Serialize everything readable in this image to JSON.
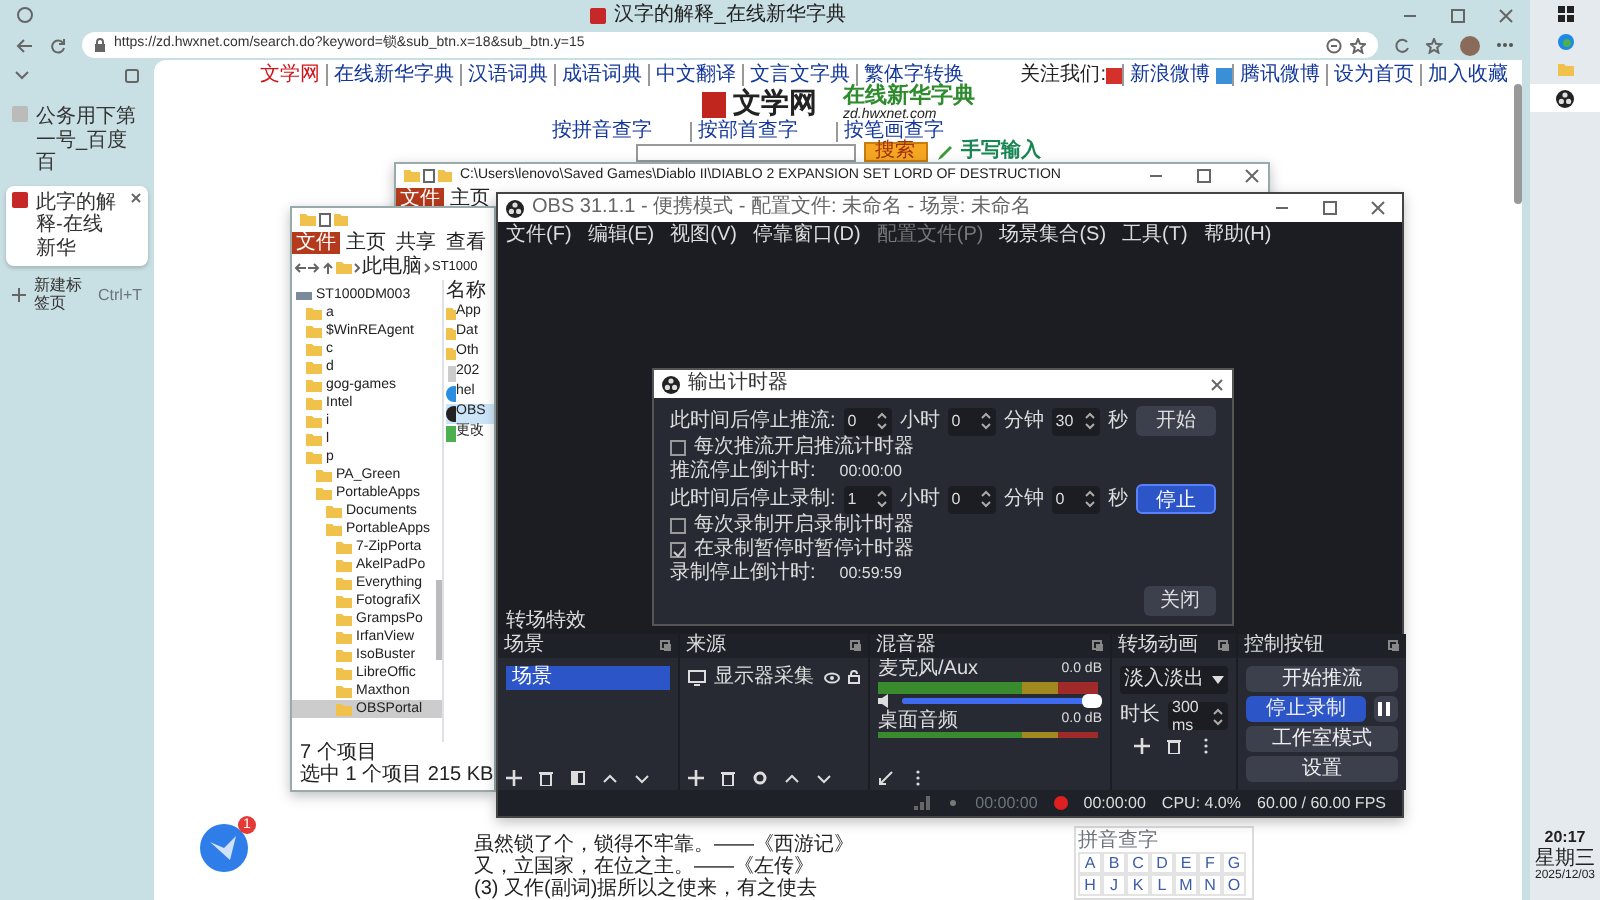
{
  "browser": {
    "title": "汉字的解释_在线新华字典",
    "url": "https://zd.hwxnet.com/search.do?keyword=锁&sub_btn.x=18&sub_btn.y=15",
    "tabs": [
      {
        "label": "公务用下第一号_百度百",
        "selected": false
      },
      {
        "label": "此字的解释-在线新华",
        "selected": true
      }
    ],
    "new_tab": {
      "label": "新建标签页",
      "shortcut": "Ctrl+T"
    }
  },
  "site": {
    "top_links": [
      {
        "label": "文学网",
        "selected": true
      },
      {
        "label": "在线新华字典",
        "selected": false
      },
      {
        "label": "汉语词典",
        "selected": false
      },
      {
        "label": "成语词典",
        "selected": false
      },
      {
        "label": "中文翻译",
        "selected": false
      },
      {
        "label": "文言文字典",
        "selected": false
      },
      {
        "label": "繁体字转换",
        "selected": false
      }
    ],
    "follow_label": "关注我们:",
    "follow_links": [
      "新浪微博",
      "腾讯微博",
      "设为首页",
      "加入收藏"
    ],
    "logo_text": "文学网",
    "site_name": "在线新华字典",
    "site_domain": "zd.hwxnet.com",
    "lookup_links": [
      "按拼音查字",
      "按部首查字",
      "按笔画查字"
    ],
    "search_button": "搜索",
    "handwriting": "手写输入",
    "body_lines": [
      "虽然锁了个，锁得不牢靠。——《西游记》",
      "又，立国家，在位之主。——《左传》",
      "(3) 又作(副词)据所以之使来，有之使去"
    ],
    "pinyin_title": "拼音查字",
    "pinyin_letters": [
      "A",
      "B",
      "C",
      "D",
      "E",
      "F",
      "G",
      "H",
      "J",
      "K",
      "L",
      "M",
      "N",
      "O"
    ],
    "float_badge": "1"
  },
  "explorer_back": {
    "title": "C:\\Users\\lenovo\\Saved Games\\Diablo II\\DIABLO 2 EXPANSION SET LORD OF DESTRUCTION",
    "ribbon_tabs": [
      {
        "label": "文件",
        "selected": true
      },
      {
        "label": "主页",
        "selected": false
      }
    ]
  },
  "explorer": {
    "ribbon_tabs": [
      {
        "label": "文件",
        "selected": true
      },
      {
        "label": "主页",
        "selected": false
      },
      {
        "label": "共享",
        "selected": false
      },
      {
        "label": "查看",
        "selected": false
      }
    ],
    "breadcrumb": [
      "此电脑",
      "ST1000"
    ],
    "tree": [
      {
        "label": "ST1000DM003",
        "selected": false,
        "children": [
          {
            "label": "a",
            "selected": false
          },
          {
            "label": "$WinREAgent",
            "selected": false
          },
          {
            "label": "c",
            "selected": false
          },
          {
            "label": "d",
            "selected": false
          },
          {
            "label": "gog-games",
            "selected": false
          },
          {
            "label": "Intel",
            "selected": false
          },
          {
            "label": "i",
            "selected": false
          },
          {
            "label": "l",
            "selected": false
          },
          {
            "label": "p",
            "selected": false,
            "children": [
              {
                "label": "PA_Green",
                "selected": false
              },
              {
                "label": "PortableApps",
                "selected": false,
                "children": [
                  {
                    "label": "Documents",
                    "selected": false
                  },
                  {
                    "label": "PortableApps",
                    "selected": false,
                    "children": [
                      {
                        "label": "7-ZipPorta",
                        "selected": false
                      },
                      {
                        "label": "AkelPadPo",
                        "selected": false
                      },
                      {
                        "label": "Everything",
                        "selected": false
                      },
                      {
                        "label": "FotografiX",
                        "selected": false
                      },
                      {
                        "label": "GrampsPo",
                        "selected": false
                      },
                      {
                        "label": "IrfanView",
                        "selected": false
                      },
                      {
                        "label": "IsoBuster",
                        "selected": false
                      },
                      {
                        "label": "LibreOffic",
                        "selected": false
                      },
                      {
                        "label": "Maxthon",
                        "selected": false
                      },
                      {
                        "label": "OBSPortal",
                        "selected": true
                      }
                    ]
                  }
                ]
              }
            ]
          }
        ]
      }
    ],
    "column": "名称",
    "files": [
      {
        "label": "App",
        "kind": "folder",
        "selected": false
      },
      {
        "label": "Dat",
        "kind": "folder",
        "selected": false
      },
      {
        "label": "Oth",
        "kind": "folder",
        "selected": false
      },
      {
        "label": "202",
        "kind": "file",
        "selected": false
      },
      {
        "label": "hel",
        "kind": "browser",
        "selected": false
      },
      {
        "label": "OBS",
        "kind": "app",
        "selected": true
      },
      {
        "label": "更改",
        "kind": "shortcut",
        "selected": false
      }
    ],
    "status": "7 个项目",
    "selection": "选中 1 个项目 215 KB"
  },
  "obs": {
    "title": "OBS 31.1.1 - 便携模式 - 配置文件: 未命名 - 场景: 未命名",
    "menu": [
      {
        "label": "文件(F)",
        "disabled": false
      },
      {
        "label": "编辑(E)",
        "disabled": false
      },
      {
        "label": "视图(V)",
        "disabled": false
      },
      {
        "label": "停靠窗口(D)",
        "disabled": false
      },
      {
        "label": "配置文件(P)",
        "disabled": true
      },
      {
        "label": "场景集合(S)",
        "disabled": false
      },
      {
        "label": "工具(T)",
        "disabled": false
      },
      {
        "label": "帮助(H)",
        "disabled": false
      }
    ],
    "timer_dialog": {
      "title": "输出计时器",
      "rows": [
        {
          "kind": "timer",
          "label": "此时间后停止推流:",
          "values": [
            "0",
            "0",
            "30"
          ],
          "units": [
            "小时",
            "分钟",
            "秒"
          ],
          "button": {
            "label": "开始",
            "active": false
          }
        },
        {
          "kind": "check",
          "label": "每次推流开启推流计时器",
          "checked": false
        },
        {
          "kind": "readout",
          "label": "推流停止倒计时:",
          "value": "00:00:00"
        },
        {
          "kind": "timer",
          "label": "此时间后停止录制:",
          "values": [
            "1",
            "0",
            "0"
          ],
          "units": [
            "小时",
            "分钟",
            "秒"
          ],
          "button": {
            "label": "停止",
            "active": true
          }
        },
        {
          "kind": "check",
          "label": "每次录制开启录制计时器",
          "checked": false
        },
        {
          "kind": "check",
          "label": "在录制暂停时暂停计时器",
          "checked": true
        },
        {
          "kind": "readout",
          "label": "录制停止倒计时:",
          "value": "00:59:59"
        }
      ],
      "close": "关闭"
    },
    "transition_label": "转场特效",
    "scenes": {
      "title": "场景",
      "items": [
        {
          "label": "场景",
          "selected": true
        }
      ]
    },
    "sources": {
      "title": "来源",
      "items": [
        {
          "label": "显示器采集"
        }
      ]
    },
    "mixer": {
      "title": "混音器",
      "channels": [
        {
          "name": "麦克风/Aux",
          "reading": "0.0 dB",
          "level": 1.0
        },
        {
          "name": "桌面音频",
          "reading": "0.0 dB"
        }
      ]
    },
    "transitions": {
      "title": "转场动画",
      "type": "淡入淡出",
      "duration_label": "时长",
      "duration": "300 ms"
    },
    "controls": {
      "title": "控制按钮",
      "buttons": [
        {
          "label": "开始推流",
          "active": false
        },
        {
          "label": "停止录制",
          "active": true
        },
        {
          "label": "工作室模式",
          "active": false
        },
        {
          "label": "设置",
          "active": false
        }
      ]
    },
    "status": {
      "stream_time": "00:00:00",
      "record_time": "00:00:00",
      "cpu": "CPU: 4.0%",
      "fps": "60.00 / 60.00 FPS"
    }
  },
  "taskbar": {
    "time": "20:17",
    "weekday": "星期三",
    "date": "2025/12/03"
  }
}
